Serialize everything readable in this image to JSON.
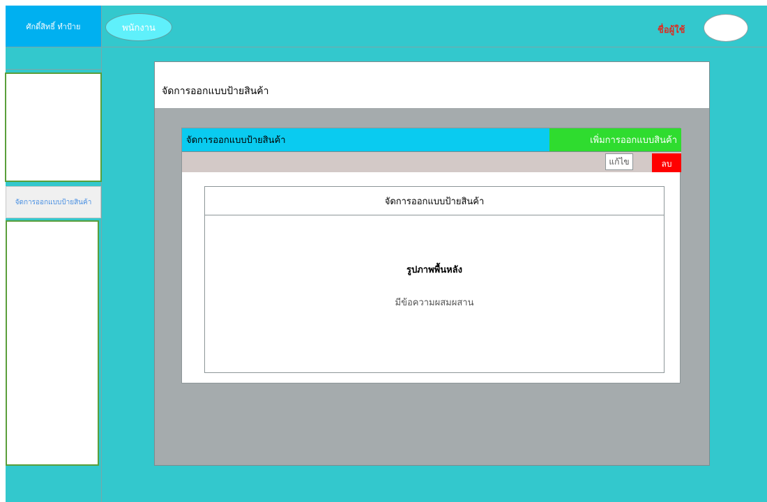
{
  "header": {
    "brand_label": "ศักดิ์สิทธิ์ ทำป้าย",
    "role_label": "พนักงาน",
    "username_label": "ชื่อผู้ใช้"
  },
  "sidebar": {
    "nav_item_label": "จัดการออกแบบป้ายสินค้า"
  },
  "main": {
    "panel_title": "จัดการออกแบบป้ายสินค้า",
    "section_title": "จัดการออกแบบป้ายสินค้า",
    "add_button_label": "เพิ่มการออกแบบสินค้า",
    "edit_button_label": "แก้ไข",
    "delete_button_label": "ลบ",
    "card": {
      "title": "จัดการออกแบบป้ายสินค้า",
      "heading": "รูปภาพพื้นหลัง",
      "text": "มีข้อความผสมผสาน"
    }
  },
  "colors": {
    "background": "#33c8cd",
    "brand": "#00b0f0",
    "section_bar": "#0acbf0",
    "add_button": "#2fdc2f",
    "delete_button": "#ff0000",
    "username": "#d93025"
  }
}
